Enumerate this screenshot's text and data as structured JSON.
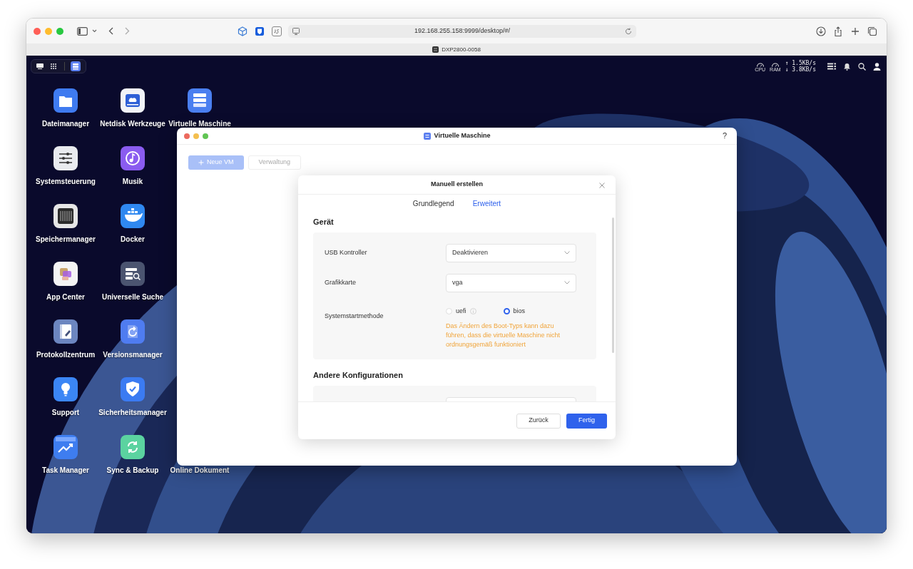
{
  "browser": {
    "url": "192.168.255.158:9999/desktop/#/",
    "tab_title": "DXP2800-0058"
  },
  "launcher": [
    {
      "kind": "desktop",
      "selected": false
    },
    {
      "kind": "apps",
      "selected": false
    },
    {
      "kind": "vm",
      "selected": true
    }
  ],
  "status": {
    "cpu": "CPU",
    "ram": "RAM",
    "upload": "↑ 1.5KB/s",
    "download": "↓ 3.8KB/s"
  },
  "desktop_icons": [
    [
      {
        "kind": "folder",
        "label": "Dateimanager"
      },
      {
        "kind": "drive",
        "label": "Netdisk Werkzeuge"
      },
      {
        "kind": "server",
        "label": "Virtuelle Maschine"
      }
    ],
    [
      {
        "kind": "sliders",
        "label": "Systemsteuerung"
      },
      {
        "kind": "music",
        "label": "Musik"
      }
    ],
    [
      {
        "kind": "bays",
        "label": "Speichermanager"
      },
      {
        "kind": "whale",
        "label": "Docker"
      }
    ],
    [
      {
        "kind": "squares",
        "label": "App Center"
      },
      {
        "kind": "listsearch",
        "label": "Universelle Suche"
      }
    ],
    [
      {
        "kind": "notebook",
        "label": "Protokollzentrum"
      },
      {
        "kind": "restore",
        "label": "Versionsmanager"
      }
    ],
    [
      {
        "kind": "bulb",
        "label": "Support"
      },
      {
        "kind": "shield",
        "label": "Sicherheitsmanager"
      }
    ],
    [
      {
        "kind": "chart",
        "label": "Task Manager"
      },
      {
        "kind": "sync",
        "label": "Sync & Backup"
      },
      {
        "kind": "none",
        "label": "Online Dokument"
      }
    ]
  ],
  "vm_window": {
    "title": "Virtuelle Maschine",
    "help": "?",
    "toolbar": [
      {
        "kind": "primary",
        "label": "Neue VM",
        "disabled": true
      },
      {
        "kind": "secondary",
        "label": "Verwaltung",
        "disabled": true
      }
    ]
  },
  "dialog": {
    "title": "Manuell erstellen",
    "tabs": [
      {
        "label": "Grundlegend",
        "selected": false
      },
      {
        "label": "Erweitert",
        "selected": true
      }
    ],
    "sections": [
      {
        "title": "Gerät",
        "rows": [
          {
            "kind": "select",
            "label": "USB Kontroller",
            "value": "Deaktivieren"
          },
          {
            "kind": "select",
            "label": "Grafikkarte",
            "value": "vga"
          },
          {
            "kind": "radio",
            "label": "Systemstartmethode",
            "options": [
              {
                "label": "uefi",
                "selected": false,
                "info": true
              },
              {
                "label": "bios",
                "selected": true,
                "info": false
              }
            ],
            "warning": "Das Ändern des Boot-Typs kann dazu führen, dass die virtuelle Maschine nicht ordnungsgemäß funktioniert"
          }
        ]
      },
      {
        "title": "Andere Konfigurationen",
        "rows": [
          {
            "kind": "select"
          }
        ]
      }
    ],
    "buttons": [
      {
        "kind": "secondary",
        "label": "Zurück"
      },
      {
        "kind": "primary",
        "label": "Fertig"
      }
    ]
  }
}
